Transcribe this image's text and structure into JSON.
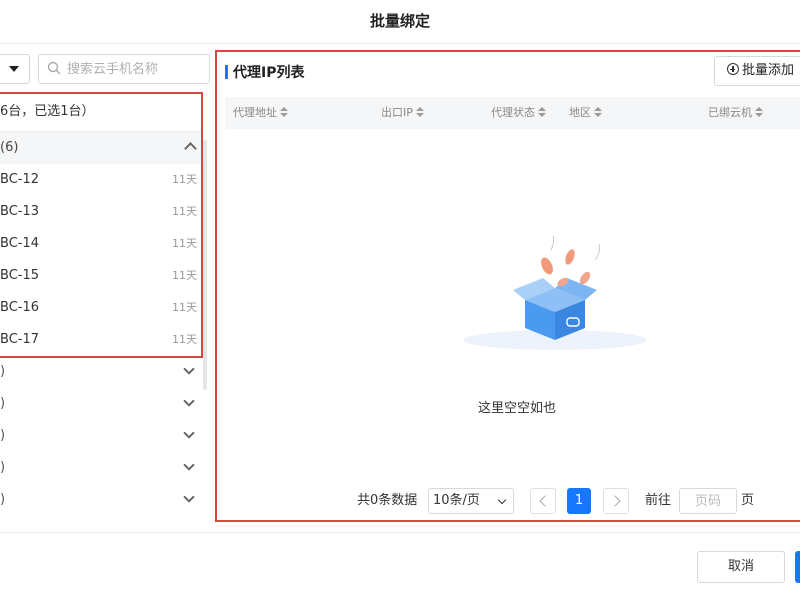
{
  "dialog": {
    "title": "批量绑定"
  },
  "left": {
    "search_placeholder": "搜索云手机名称",
    "group_summary": "6台，已选1台）",
    "group_name": "(6)",
    "devices": [
      {
        "name": "BC-12",
        "days": "11天"
      },
      {
        "name": "BC-13",
        "days": "11天"
      },
      {
        "name": "BC-14",
        "days": "11天"
      },
      {
        "name": "BC-15",
        "days": "11天"
      },
      {
        "name": "BC-16",
        "days": "11天"
      },
      {
        "name": "BC-17",
        "days": "11天"
      }
    ],
    "collapsed_groups": [
      {
        "label": ")"
      },
      {
        "label": ")"
      },
      {
        "label": ")"
      },
      {
        "label": ")"
      },
      {
        "label": ")"
      }
    ]
  },
  "right": {
    "title": "代理IP列表",
    "batch_add_label": "批量添加",
    "columns": [
      "代理地址",
      "出口IP",
      "代理状态",
      "地区",
      "已绑云机"
    ],
    "empty_text": "这里空空如也",
    "pagination": {
      "total_text": "共0条数据",
      "page_size": "10条/页",
      "current_page": "1",
      "goto_label": "前往",
      "goto_placeholder": "页码",
      "page_suffix": "页"
    }
  },
  "footer": {
    "cancel_label": "取消"
  },
  "colors": {
    "accent": "#1677ff",
    "highlight_border": "#d9463f"
  }
}
